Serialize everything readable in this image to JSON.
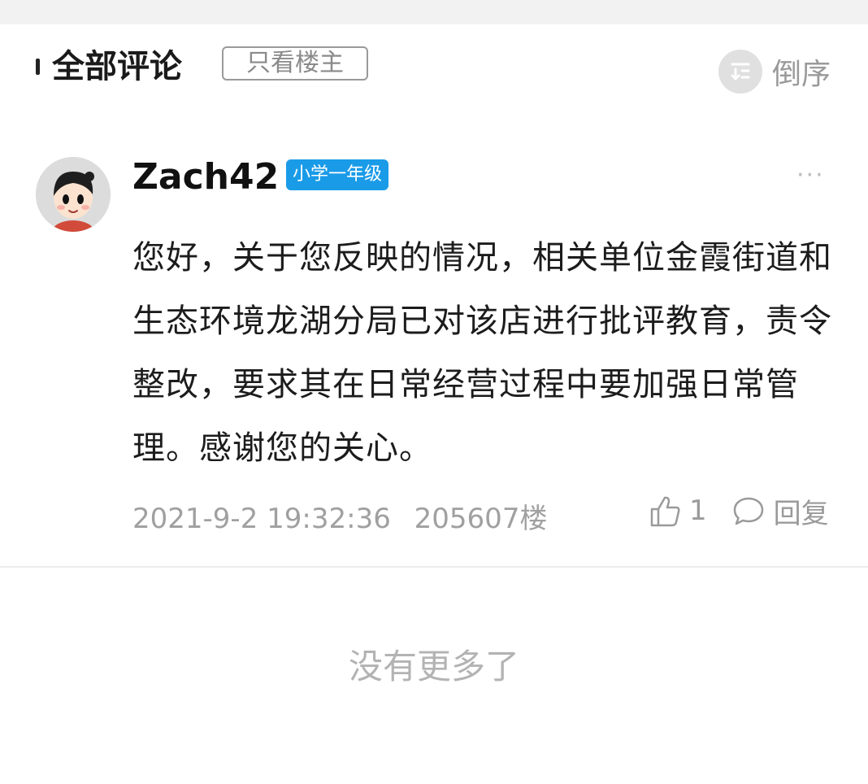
{
  "header": {
    "title": "全部评论",
    "op_only_label": "只看楼主",
    "sort_label": "倒序"
  },
  "comment": {
    "username": "Zach42",
    "level": "小学一年级",
    "more": "···",
    "content": "您好，关于您反映的情况，相关单位金霞街道和生态环境龙湖分局已对该店进行批评教育，责令整改，要求其在日常经营过程中要加强日常管理。感谢您的关心。",
    "timestamp": "2021-9-2 19:32:36",
    "floor": "205607楼",
    "like_count": "1",
    "reply_label": "回复"
  },
  "footer": {
    "no_more": "没有更多了"
  },
  "colors": {
    "accent": "#1a9be8",
    "text_primary": "#1c1c1c",
    "text_secondary": "#a0a0a0"
  },
  "icons": {
    "sort": "sort-icon",
    "like": "thumb-up-icon",
    "reply": "comment-bubble-icon",
    "more": "more-dots-icon"
  }
}
